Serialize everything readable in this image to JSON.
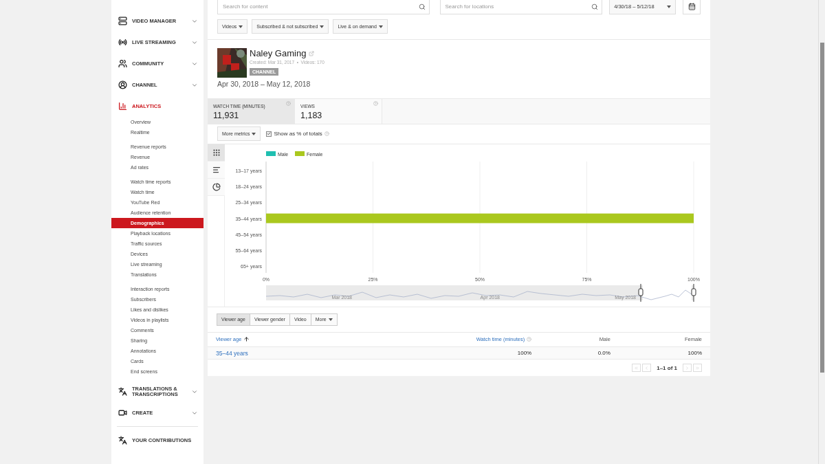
{
  "sidebar": {
    "items": [
      {
        "kind": "section",
        "label": "VIDEO MANAGER",
        "expanded": false,
        "selected": false
      },
      {
        "kind": "section",
        "label": "LIVE STREAMING",
        "expanded": false,
        "selected": false
      },
      {
        "kind": "section",
        "label": "COMMUNITY",
        "expanded": false,
        "selected": false
      },
      {
        "kind": "section",
        "label": "CHANNEL",
        "expanded": false,
        "selected": false
      },
      {
        "kind": "section",
        "label": "ANALYTICS",
        "expanded": true,
        "selected": true,
        "groups": [
          {
            "items": [
              {
                "label": "Overview",
                "selected": false
              },
              {
                "label": "Realtime",
                "selected": false
              }
            ]
          },
          {
            "items": [
              {
                "label": "Revenue reports",
                "selected": false
              },
              {
                "label": "Revenue",
                "selected": false
              },
              {
                "label": "Ad rates",
                "selected": false
              }
            ]
          },
          {
            "items": [
              {
                "label": "Watch time reports",
                "selected": false
              },
              {
                "label": "Watch time",
                "selected": false
              },
              {
                "label": "YouTube Red",
                "selected": false
              },
              {
                "label": "Audience retention",
                "selected": false
              },
              {
                "label": "Demographics",
                "selected": true
              },
              {
                "label": "Playback locations",
                "selected": false
              },
              {
                "label": "Traffic sources",
                "selected": false
              },
              {
                "label": "Devices",
                "selected": false
              },
              {
                "label": "Live streaming",
                "selected": false
              },
              {
                "label": "Translations",
                "selected": false
              }
            ]
          },
          {
            "items": [
              {
                "label": "Interaction reports",
                "selected": false
              },
              {
                "label": "Subscribers",
                "selected": false
              },
              {
                "label": "Likes and dislikes",
                "selected": false
              },
              {
                "label": "Videos in playlists",
                "selected": false
              },
              {
                "label": "Comments",
                "selected": false
              },
              {
                "label": "Sharing",
                "selected": false
              },
              {
                "label": "Annotations",
                "selected": false
              },
              {
                "label": "Cards",
                "selected": false
              },
              {
                "label": "End screens",
                "selected": false
              }
            ]
          }
        ]
      },
      {
        "kind": "section",
        "label": "TRANSLATIONS & TRANSCRIPTIONS",
        "expanded": false,
        "selected": false
      },
      {
        "kind": "section",
        "label": "CREATE",
        "expanded": false,
        "selected": false
      },
      {
        "kind": "link",
        "label": "YOUR CONTRIBUTIONS",
        "selected": false
      }
    ]
  },
  "search": {
    "content_placeholder": "Search for content",
    "locations_placeholder": "Search for locations",
    "date_range": "4/30/18 – 5/12/18"
  },
  "filters": [
    "Videos",
    "Subscribed & not subscribed",
    "Live & on demand"
  ],
  "channel": {
    "name": "Naley Gaming",
    "meta": "Created: Mar 31, 2017  •  Videos: 170",
    "badge": "CHANNEL",
    "period": "Apr 30, 2018 – May 12, 2018"
  },
  "metrics": [
    {
      "label": "WATCH TIME (MINUTES)",
      "value": "11,931",
      "selected": true
    },
    {
      "label": "VIEWS",
      "value": "1,183",
      "selected": false
    }
  ],
  "more_metrics": "More metrics",
  "show_percent": {
    "label": "Show as % of totals",
    "checked": true
  },
  "chart_types": [
    {
      "kind": "stacked",
      "selected": true
    },
    {
      "kind": "bar",
      "selected": false
    },
    {
      "kind": "pie",
      "selected": false
    }
  ],
  "chart_data": {
    "type": "bar",
    "orientation": "horizontal",
    "categories": [
      "13–17 years",
      "18–24 years",
      "25–34 years",
      "35–44 years",
      "45–54 years",
      "55–64 years",
      "65+ years"
    ],
    "series": [
      {
        "name": "Male",
        "color": "#1fbfb0",
        "values": [
          0,
          0,
          0,
          0,
          0,
          0,
          0
        ]
      },
      {
        "name": "Female",
        "color": "#aac81e",
        "values": [
          0,
          0,
          0,
          100,
          0,
          0,
          0
        ]
      }
    ],
    "xlim": [
      0,
      100
    ],
    "grid": true,
    "xticks": [
      {
        "value": 0,
        "label": "0%"
      },
      {
        "value": 25,
        "label": "25%"
      },
      {
        "value": 50,
        "label": "50%"
      },
      {
        "value": 75,
        "label": "75%"
      },
      {
        "value": 100,
        "label": "100%"
      }
    ]
  },
  "navigator": {
    "labels": [
      "Mar 2018",
      "Apr 2018",
      "May 2018"
    ]
  },
  "table_tabs": [
    {
      "kind": "tab",
      "label": "Viewer age",
      "selected": true
    },
    {
      "kind": "tab",
      "label": "Viewer gender",
      "selected": false
    },
    {
      "kind": "tab",
      "label": "Video",
      "selected": false
    },
    {
      "kind": "menu",
      "label": "More",
      "selected": false
    }
  ],
  "table": {
    "columns": [
      {
        "label": "Viewer age",
        "sorted": true,
        "help": false
      },
      {
        "label": "Watch time (minutes)",
        "sorted": false,
        "help": true
      },
      {
        "label": "Male",
        "sorted": false,
        "help": false
      },
      {
        "label": "Female",
        "sorted": false,
        "help": false
      }
    ],
    "rows": [
      [
        "35–44 years",
        "100%",
        "0.0%",
        "100%"
      ]
    ]
  },
  "pagination": "1–1 of 1"
}
